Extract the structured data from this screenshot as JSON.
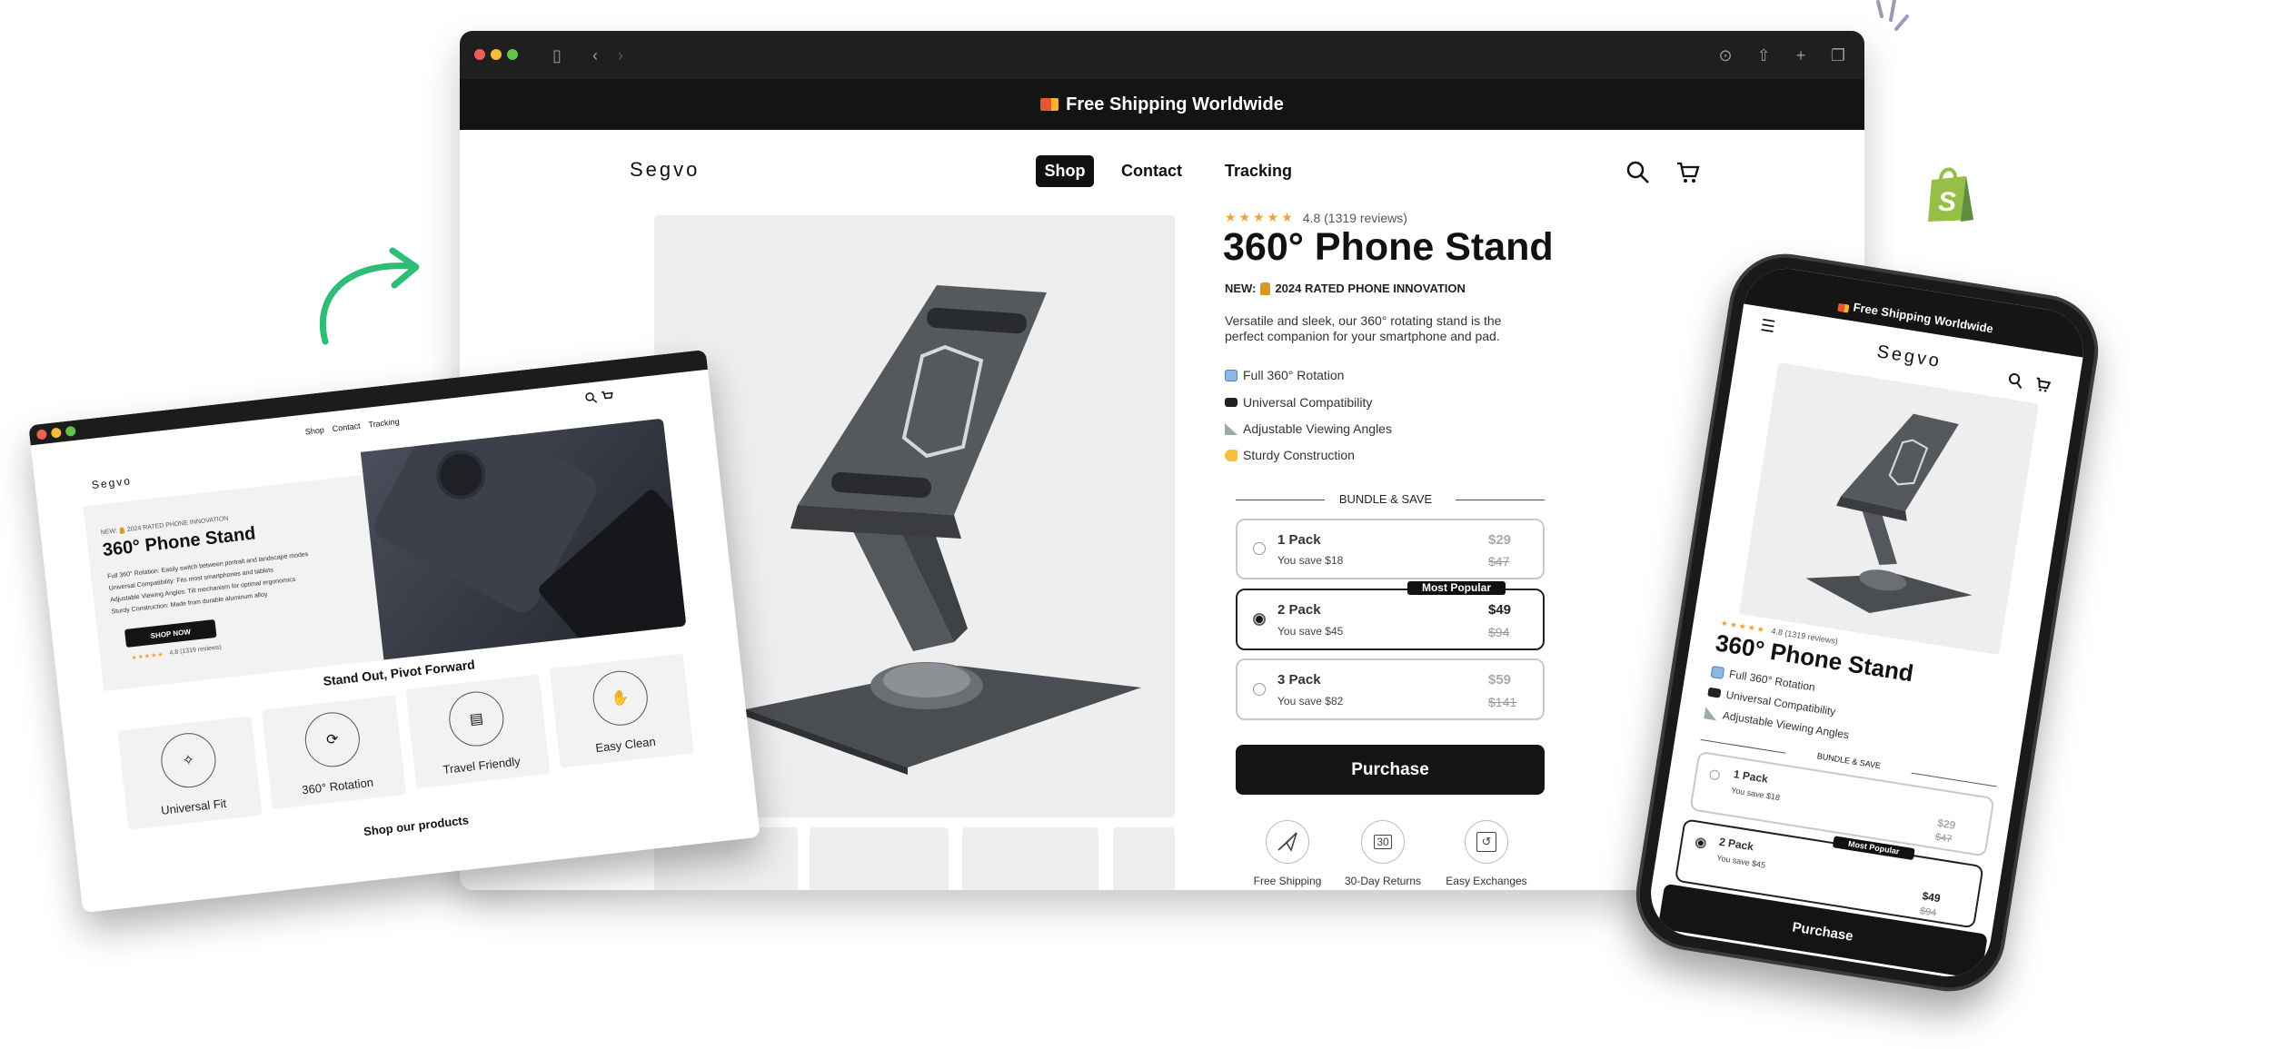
{
  "main_browser": {
    "announcement": "Free Shipping Worldwide",
    "logo": "Segvo",
    "nav": [
      "Shop",
      "Contact",
      "Tracking"
    ],
    "product": {
      "stars": "★★★★★",
      "rating": "4.8 (1319 reviews)",
      "title": "360° Phone Stand",
      "badge_prefix": "NEW:",
      "badge_text": "2024 RATED PHONE INNOVATION",
      "description_1": "Versatile and sleek, our 360° rotating stand is the",
      "description_2": "perfect companion for your smartphone and pad.",
      "features": [
        {
          "icon": "rotation-emoji-icon",
          "label": "Full 360° Rotation"
        },
        {
          "icon": "monitor-emoji-icon",
          "label": "Universal Compatibility"
        },
        {
          "icon": "triangle-ruler-emoji-icon",
          "label": "Adjustable Viewing Angles"
        },
        {
          "icon": "flexed-biceps-emoji-icon",
          "label": "Sturdy Construction"
        }
      ],
      "bundle_title": "BUNDLE & SAVE",
      "options": [
        {
          "name": "1 Pack",
          "save": "You save $18",
          "price": "$29",
          "compare": "$47",
          "selected": false
        },
        {
          "name": "2 Pack",
          "save": "You save $45",
          "price": "$49",
          "compare": "$94",
          "selected": true,
          "badge": "Most Popular"
        },
        {
          "name": "3 Pack",
          "save": "You save $82",
          "price": "$59",
          "compare": "$141",
          "selected": false
        }
      ],
      "purchase": "Purchase",
      "guarantees": [
        {
          "icon": "paper-plane-icon",
          "label": "Free Shipping"
        },
        {
          "icon": "calendar-30-icon",
          "label": "30-Day Returns",
          "icon_text": "30"
        },
        {
          "icon": "exchange-box-icon",
          "label": "Easy Exchanges"
        }
      ]
    }
  },
  "left_browser": {
    "logo": "Segvo",
    "nav": [
      "Shop",
      "Contact",
      "Tracking"
    ],
    "hero": {
      "kicker_prefix": "NEW:",
      "kicker": "2024 RATED PHONE INNOVATION",
      "title": "360° Phone Stand",
      "features": [
        "Full 360° Rotation: Easily switch between portrait and landscape modes",
        "Universal Compatibility: Fits most smartphones and tablets",
        "Adjustable Viewing Angles: Tilt mechanism for optimal ergonomics",
        "Sturdy Construction: Made from durable aluminum alloy"
      ],
      "cta": "SHOP NOW",
      "stars": "★★★★★",
      "rating": "4.8 (1319 reviews)"
    },
    "section_title": "Stand Out, Pivot Forward",
    "cards": [
      "Universal Fit",
      "360° Rotation",
      "Travel Friendly",
      "Easy Clean"
    ],
    "shop_title": "Shop our products"
  },
  "phone": {
    "announcement": "Free Shipping Worldwide",
    "logo": "Segvo",
    "stars": "★★★★★",
    "rating": "4.8 (1319 reviews)",
    "title": "360° Phone Stand",
    "features": [
      "Full 360° Rotation",
      "Universal Compatibility",
      "Adjustable Viewing Angles"
    ],
    "bundle_title": "BUNDLE & SAVE",
    "options": [
      {
        "name": "1 Pack",
        "save": "You save $18",
        "price": "$29",
        "compare": "$47"
      },
      {
        "name": "2 Pack",
        "save": "You save $45",
        "price": "$49",
        "compare": "$94",
        "badge": "Most Popular"
      }
    ],
    "purchase": "Purchase"
  },
  "colors": {
    "accent": "#111111",
    "stars": "#f0a23a",
    "arrow": "#2dbd74",
    "shopify": "#95bf47"
  }
}
